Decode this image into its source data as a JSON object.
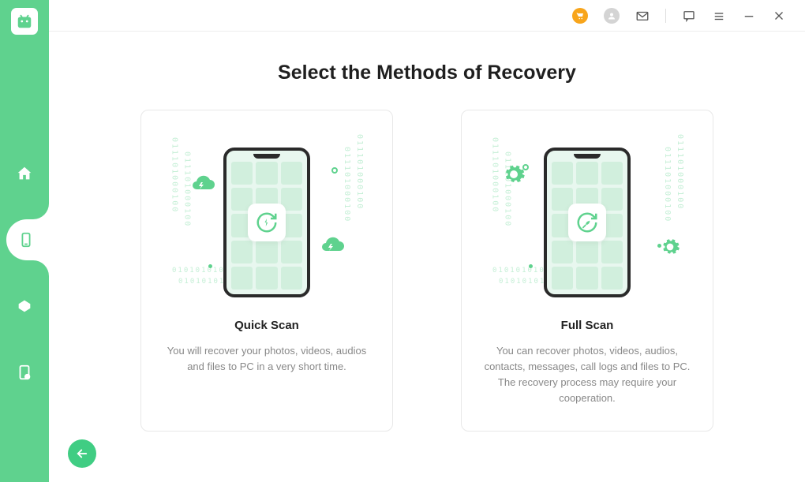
{
  "page": {
    "title": "Select the Methods of Recovery"
  },
  "sidebar": {
    "items": [
      {
        "name": "home"
      },
      {
        "name": "device",
        "active": true
      },
      {
        "name": "cloud"
      },
      {
        "name": "sim"
      }
    ]
  },
  "titlebar": {
    "icons": [
      "cart",
      "user",
      "mail",
      "feedback",
      "menu",
      "minimize",
      "close"
    ]
  },
  "cards": [
    {
      "id": "quick-scan",
      "title": "Quick Scan",
      "description": "You will recover your photos, videos, audios and files to PC in a very short time.",
      "icon_type": "lightning"
    },
    {
      "id": "full-scan",
      "title": "Full Scan",
      "description": "You can recover photos, videos, audios, contacts, messages, call logs and files to PC. The recovery process may require your cooperation.",
      "icon_type": "wrench"
    }
  ],
  "colors": {
    "accent": "#5fd28e",
    "cart_badge": "#f8a51b"
  },
  "decor": {
    "binary_v": "011101000100",
    "binary_h": "01010101010101"
  }
}
